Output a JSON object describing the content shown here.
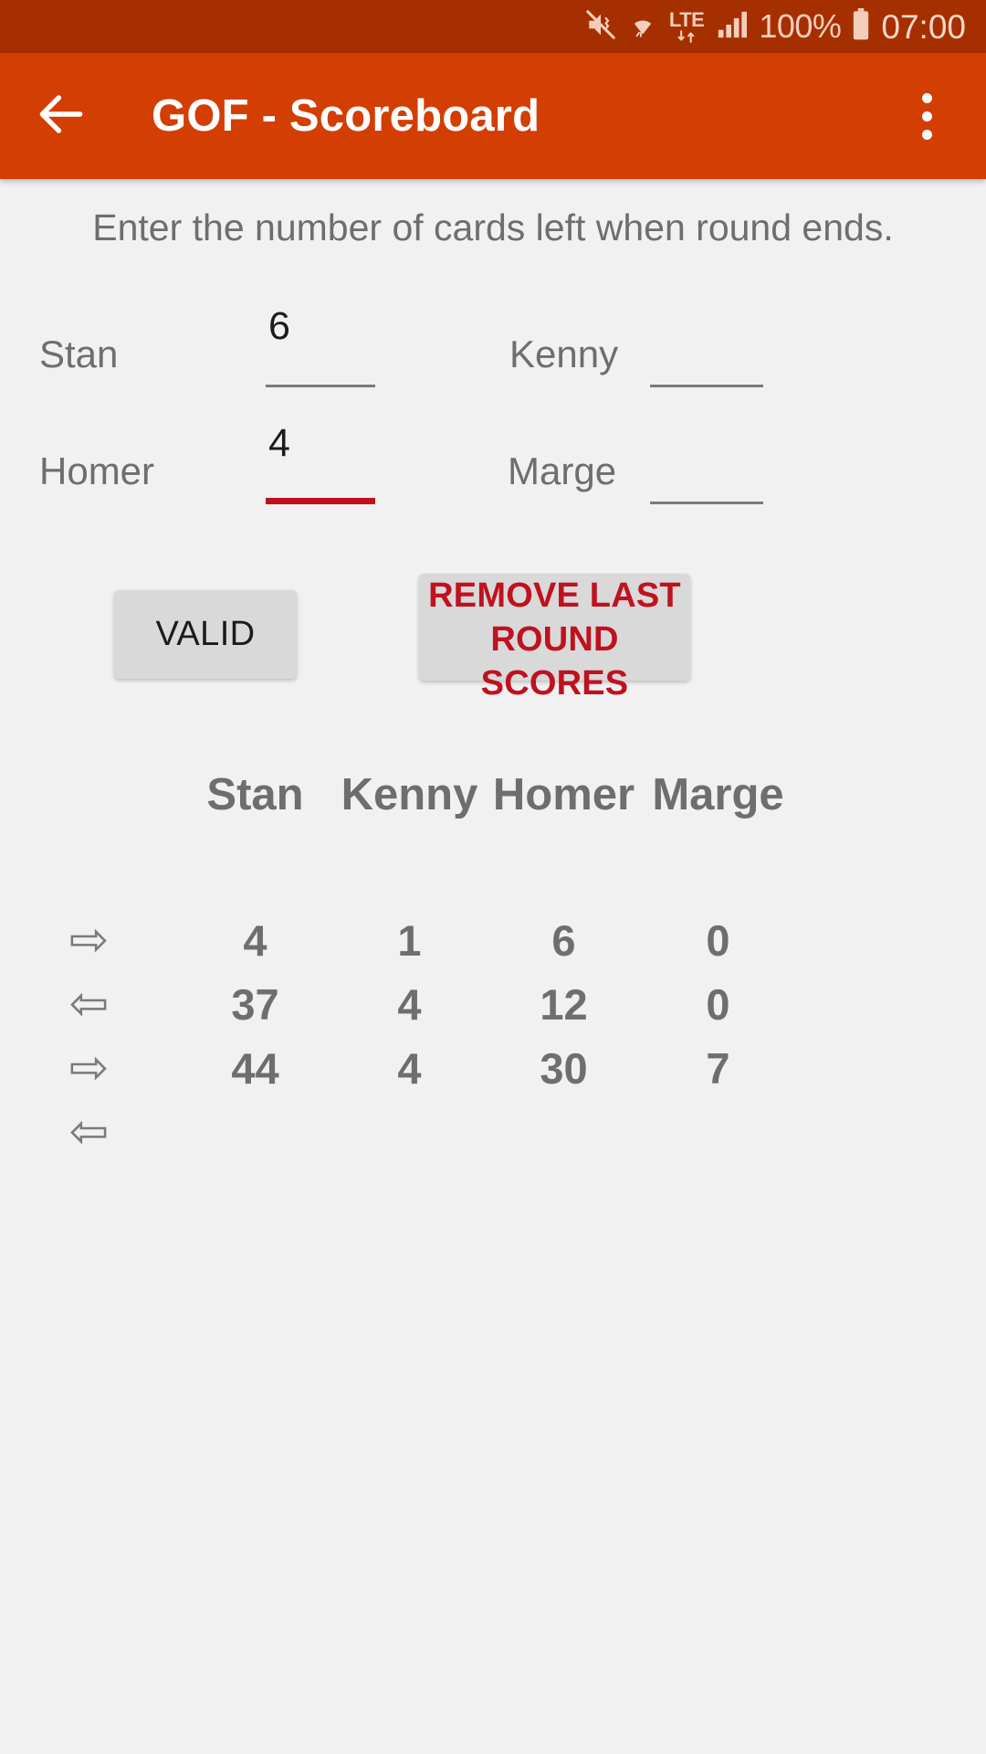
{
  "status_bar": {
    "icons": [
      "mute-vibrate-icon",
      "wifi-icon",
      "lte-icon",
      "signal-bars-icon",
      "battery-icon"
    ],
    "lte_label": "LTE",
    "battery_percent": "100%",
    "clock": "07:00"
  },
  "app_bar": {
    "back_icon": "back-arrow-icon",
    "title": "GOF - Scoreboard",
    "overflow_icon": "overflow-menu-icon",
    "background_color": "#d33e02"
  },
  "content": {
    "instruction": "Enter the number of cards left when round ends."
  },
  "inputs": {
    "rows": [
      {
        "left": {
          "label": "Stan",
          "value": "6",
          "placeholder": "",
          "state": "normal"
        },
        "right": {
          "label": "Kenny",
          "value": "",
          "placeholder": "",
          "state": "normal"
        }
      },
      {
        "left": {
          "label": "Homer",
          "value": "4",
          "placeholder": "",
          "state": "error"
        },
        "right": {
          "label": "Marge",
          "value": "",
          "placeholder": "",
          "state": "normal"
        }
      }
    ],
    "error_color": "#c0111f",
    "line_color": "#7a7a7a"
  },
  "buttons": {
    "valid_label": "VALID",
    "remove_label": "REMOVE LAST ROUND SCORES",
    "remove_color": "#c0111f"
  },
  "chart_data": {
    "type": "table",
    "title": "",
    "columns": [
      "",
      "Stan",
      "Kenny",
      "Homer",
      "Marge"
    ],
    "rows": [
      {
        "direction": "right-arrow-icon",
        "arrow": "⇨",
        "values": [
          "4",
          "1",
          "6",
          "0"
        ]
      },
      {
        "direction": "left-arrow-icon",
        "arrow": "⇦",
        "values": [
          "37",
          "4",
          "12",
          "0"
        ]
      },
      {
        "direction": "right-arrow-icon",
        "arrow": "⇨",
        "values": [
          "44",
          "4",
          "30",
          "7"
        ]
      },
      {
        "direction": "left-arrow-icon",
        "arrow": "⇦",
        "values": [
          "",
          "",
          "",
          ""
        ]
      }
    ]
  }
}
